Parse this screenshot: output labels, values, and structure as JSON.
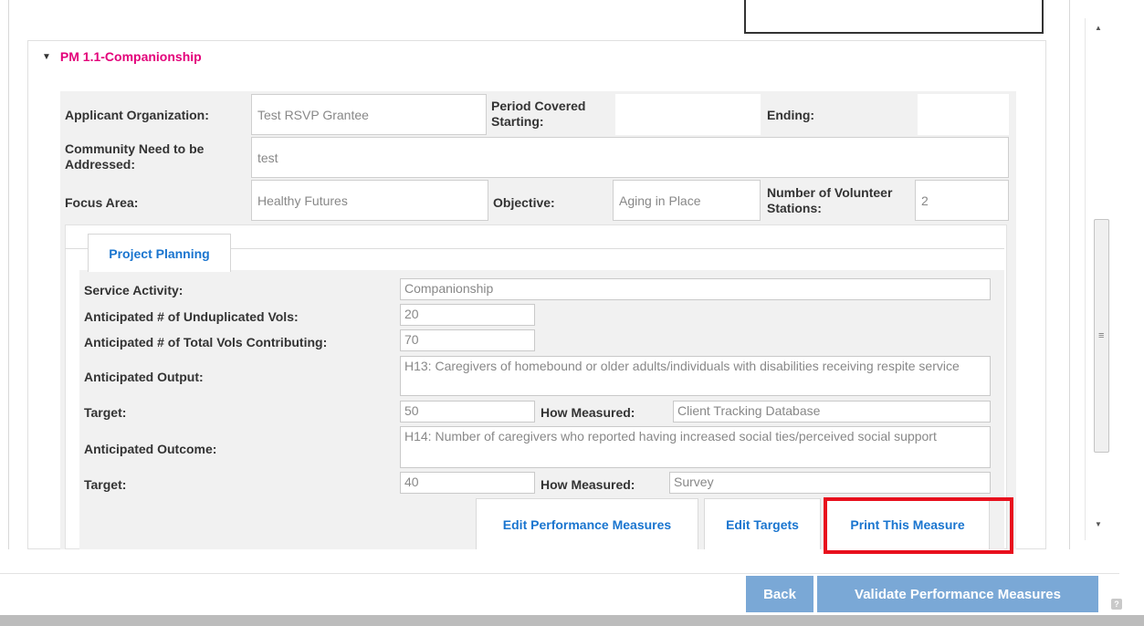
{
  "section": {
    "title": "PM 1.1-Companionship",
    "caret": "▼"
  },
  "header_info": {
    "applicant_org_label": "Applicant Organization:",
    "applicant_org_value": "Test RSVP Grantee",
    "period_label_1": "Period Covered",
    "period_label_2": "Starting:",
    "period_value": "",
    "ending_label": "Ending:",
    "ending_value": "",
    "community_need_label_1": "Community Need to be",
    "community_need_label_2": "Addressed:",
    "community_need_value": "test",
    "focus_area_label": "Focus Area:",
    "focus_area_value": "Healthy Futures",
    "objective_label": "Objective:",
    "objective_value": "Aging in Place",
    "stations_label_1": "Number of Volunteer",
    "stations_label_2": "Stations:",
    "stations_value": "2"
  },
  "tabs": {
    "project_planning": "Project Planning"
  },
  "planning": {
    "service_activity_label": "Service Activity:",
    "service_activity_value": "Companionship",
    "unduplicated_label": "Anticipated # of Unduplicated Vols:",
    "unduplicated_value": "20",
    "total_vols_label": "Anticipated # of Total Vols Contributing:",
    "total_vols_value": "70",
    "output_label": "Anticipated Output:",
    "output_value": "H13: Caregivers of homebound or older adults/individuals with disabilities receiving respite service",
    "target1_label": "Target:",
    "target1_value": "50",
    "how_measured1_label": "How Measured:",
    "how_measured1_value": "Client Tracking Database",
    "outcome_label": "Anticipated Outcome:",
    "outcome_value": "H14: Number of caregivers who reported having increased social ties/perceived social support",
    "target2_label": "Target:",
    "target2_value": "40",
    "how_measured2_label": "How Measured:",
    "how_measured2_value": "Survey"
  },
  "actions": {
    "edit_pm": "Edit Performance Measures",
    "edit_targets": "Edit Targets",
    "print_measure": "Print This Measure"
  },
  "footer": {
    "back": "Back",
    "validate": "Validate Performance Measures",
    "help": "?"
  },
  "scrollbar": {
    "up": "▲",
    "down": "▼",
    "grip": "≡"
  },
  "colors": {
    "section_title": "#e3007a",
    "link_blue": "#1a75cf",
    "button": "#7aa8d6",
    "highlight": "#e8101d"
  }
}
